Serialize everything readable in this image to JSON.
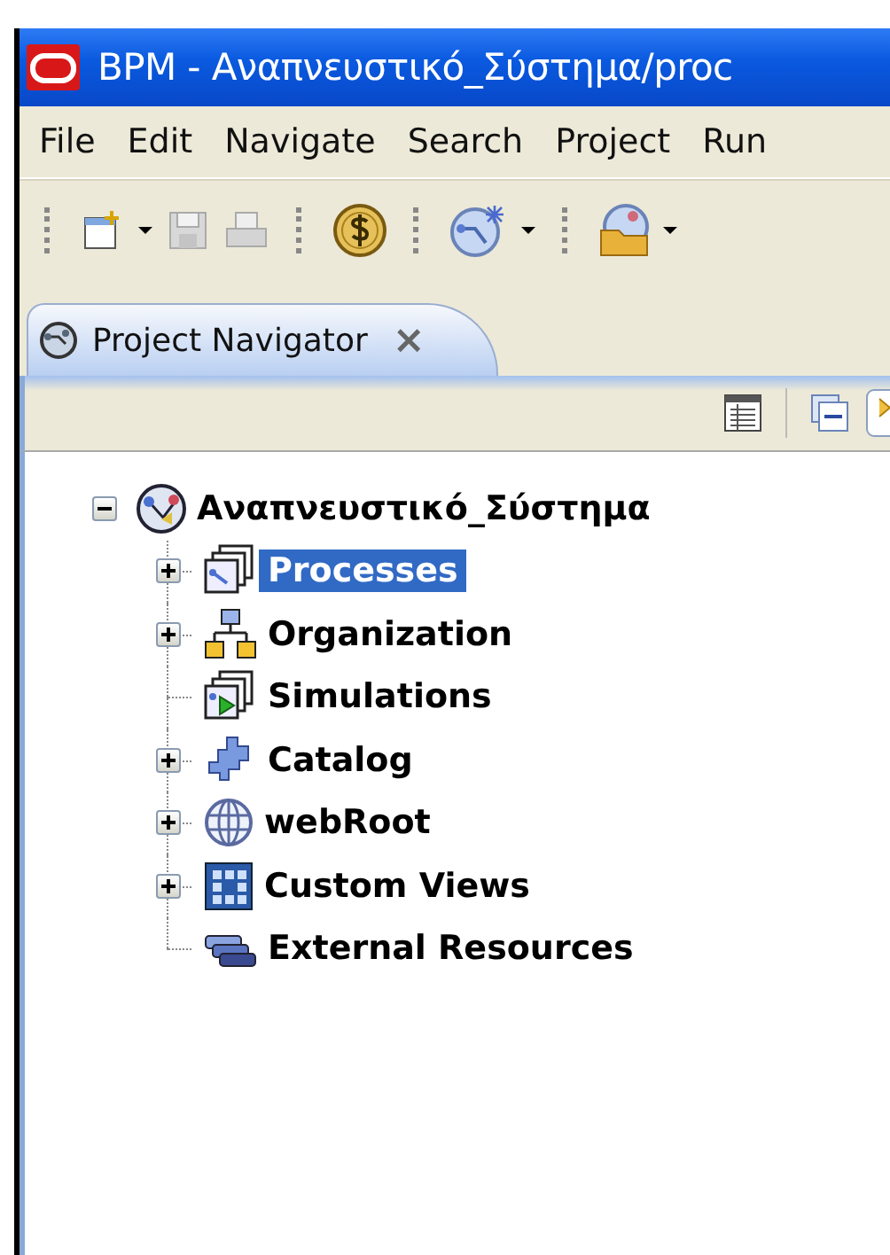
{
  "window": {
    "title": "BPM - Αναπνευστικό_Σύστημα/proc"
  },
  "menu": [
    "File",
    "Edit",
    "Navigate",
    "Search",
    "Project",
    "Run"
  ],
  "view_tab": {
    "label": "Project Navigator",
    "close": "×"
  },
  "tree": {
    "label": "Αναπνευστικό_Σύστημα",
    "expanded": true,
    "selected": false,
    "children": [
      {
        "label": "Processes",
        "kind": "processes",
        "expanded": false,
        "selected": true
      },
      {
        "label": "Organization",
        "kind": "organization",
        "expanded": false,
        "selected": false
      },
      {
        "label": "Simulations",
        "kind": "simulations",
        "selected": false
      },
      {
        "label": "Catalog",
        "kind": "catalog",
        "expanded": false,
        "selected": false
      },
      {
        "label": "webRoot",
        "kind": "web",
        "expanded": false,
        "selected": false
      },
      {
        "label": "Custom Views",
        "kind": "views",
        "expanded": false,
        "selected": false
      },
      {
        "label": "External Resources",
        "kind": "resources",
        "selected": false
      }
    ]
  }
}
